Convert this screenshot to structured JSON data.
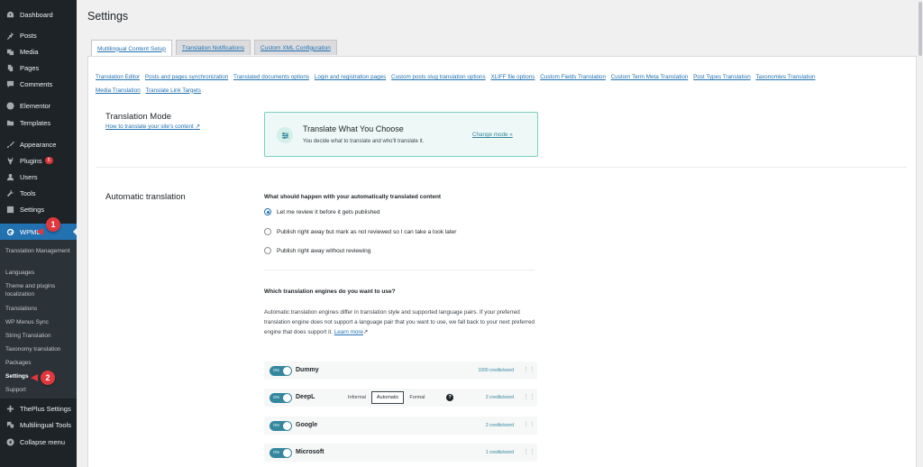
{
  "sidebar": {
    "items": [
      {
        "label": "Dashboard",
        "icon": "dashboard-icon"
      },
      {
        "label": "Posts",
        "icon": "pin-icon"
      },
      {
        "label": "Media",
        "icon": "media-icon"
      },
      {
        "label": "Pages",
        "icon": "pages-icon"
      },
      {
        "label": "Comments",
        "icon": "comments-icon"
      },
      {
        "label": "Elementor",
        "icon": "elementor-icon"
      },
      {
        "label": "Templates",
        "icon": "folder-icon"
      },
      {
        "label": "Appearance",
        "icon": "brush-icon"
      },
      {
        "label": "Plugins",
        "icon": "plugin-icon",
        "badge": "5"
      },
      {
        "label": "Users",
        "icon": "users-icon"
      },
      {
        "label": "Tools",
        "icon": "wrench-icon"
      },
      {
        "label": "Settings",
        "icon": "settings-icon"
      },
      {
        "label": "WPML",
        "icon": "wpml-icon"
      }
    ],
    "submenu": [
      "Translation Management",
      "Languages",
      "Theme and plugins localization",
      "Translations",
      "WP Menus Sync",
      "String Translation",
      "Taxonomy translation",
      "Packages",
      "Settings",
      "Support"
    ],
    "bottom": [
      {
        "label": "ThePlus Settings"
      },
      {
        "label": "Multilingual Tools"
      },
      {
        "label": "Collapse menu"
      }
    ],
    "annotations": [
      "1",
      "2"
    ]
  },
  "page": {
    "title": "Settings"
  },
  "tabs": [
    "Multilingual Content Setup",
    "Translation Notifications",
    "Custom XML Configuration"
  ],
  "sublinks": [
    "Translation Editor",
    "Posts and pages synchronization",
    "Translated documents options",
    "Login and registration pages",
    "Custom posts slug translation options",
    "XLIFF file options",
    "Custom Fields Translation",
    "Custom Term Meta Translation",
    "Post Types Translation",
    "Taxonomies Translation",
    "Media Translation",
    "Translate Link Targets"
  ],
  "translation_mode": {
    "label": "Translation Mode",
    "help_link": "How to translate your site's content",
    "card_title": "Translate What You Choose",
    "card_desc": "You decide what to translate and who'll translate it.",
    "change_link": "Change mode »"
  },
  "automatic_translation": {
    "label": "Automatic translation",
    "question1": "What should happen with your automatically translated content",
    "options": [
      {
        "label": "Let me review it before it gets published",
        "checked": true
      },
      {
        "label": "Publish right away but mark as not reviewed so I can take a look later",
        "checked": false
      },
      {
        "label": "Publish right away without reviewing",
        "checked": false
      }
    ],
    "question2": "Which translation engines do you want to use?",
    "engines_desc": "Automatic translation engines differ in translation style and supported language pairs. If your preferred translation engine does not support a language pair that you want to use, we fall back to your next preferred engine that does support it.",
    "learn_more": "Learn more",
    "engines": [
      {
        "name": "Dummy",
        "toggle": "ON",
        "credits": "1000 credits/word"
      },
      {
        "name": "DeepL",
        "toggle": "ON",
        "credits": "2 credits/word",
        "formality": [
          "Informal",
          "Automatic",
          "Formal"
        ],
        "formality_selected": "Automatic"
      },
      {
        "name": "Google",
        "toggle": "ON",
        "credits": "2 credits/word"
      },
      {
        "name": "Microsoft",
        "toggle": "ON",
        "credits": "1 credits/word"
      }
    ]
  },
  "colors": {
    "sidebar_bg": "#1d2327",
    "active_blue": "#2271b1",
    "teal": "#33879e",
    "annotation_red": "#e0383d"
  }
}
